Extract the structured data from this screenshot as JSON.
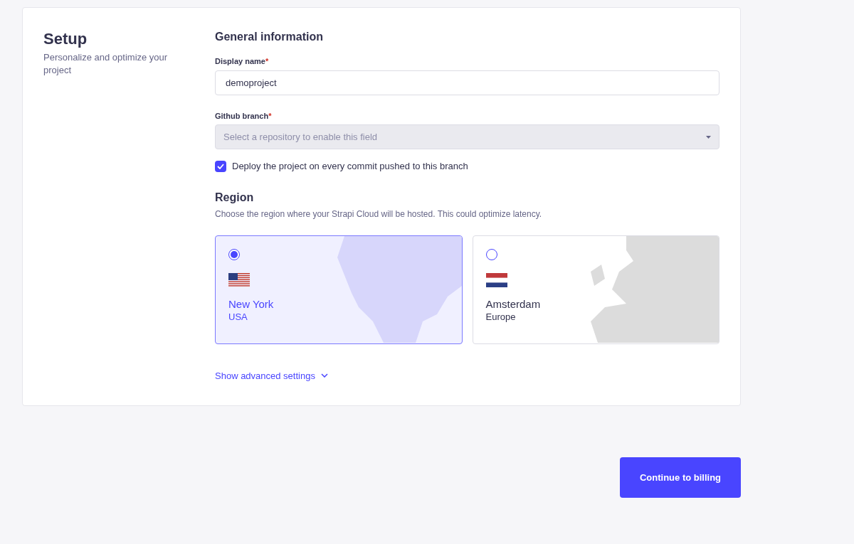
{
  "sidebar": {
    "title": "Setup",
    "description": "Personalize and optimize your project"
  },
  "general": {
    "heading": "General information",
    "display_name": {
      "label": "Display name",
      "required_mark": "*",
      "value": "demoproject"
    },
    "github_branch": {
      "label": "Github branch",
      "required_mark": "*",
      "placeholder": "Select a repository to enable this field",
      "disabled": true
    },
    "auto_deploy": {
      "label": "Deploy the project on every commit pushed to this branch",
      "checked": true
    }
  },
  "region": {
    "heading": "Region",
    "description": "Choose the region where your Strapi Cloud will be hosted. This could optimize latency.",
    "options": [
      {
        "kind": "usa",
        "city": "New York",
        "area": "USA",
        "selected": true
      },
      {
        "kind": "europe",
        "city": "Amsterdam",
        "area": "Europe",
        "selected": false
      }
    ]
  },
  "advanced_link": "Show advanced settings",
  "continue_button": "Continue to billing"
}
